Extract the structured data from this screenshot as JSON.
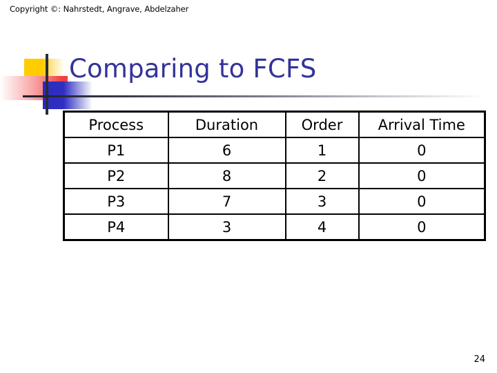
{
  "slide": {
    "copyright": "Copyright ©: Nahrstedt, Angrave, Abdelzaher",
    "title": "Comparing to FCFS",
    "page_number": "24",
    "colors": {
      "title": "#333399",
      "decor_yellow": "#FFCC00",
      "decor_red": "#F04040",
      "decor_blue": "#2A2ABE",
      "decor_bar": "#2B2B38",
      "table_border": "#000000",
      "text": "#000000",
      "background": "#FFFFFF"
    }
  },
  "table": {
    "headers": [
      "Process",
      "Duration",
      "Order",
      "Arrival Time"
    ],
    "rows": [
      [
        "P1",
        "6",
        "1",
        "0"
      ],
      [
        "P2",
        "8",
        "2",
        "0"
      ],
      [
        "P3",
        "7",
        "3",
        "0"
      ],
      [
        "P4",
        "3",
        "4",
        "0"
      ]
    ]
  }
}
